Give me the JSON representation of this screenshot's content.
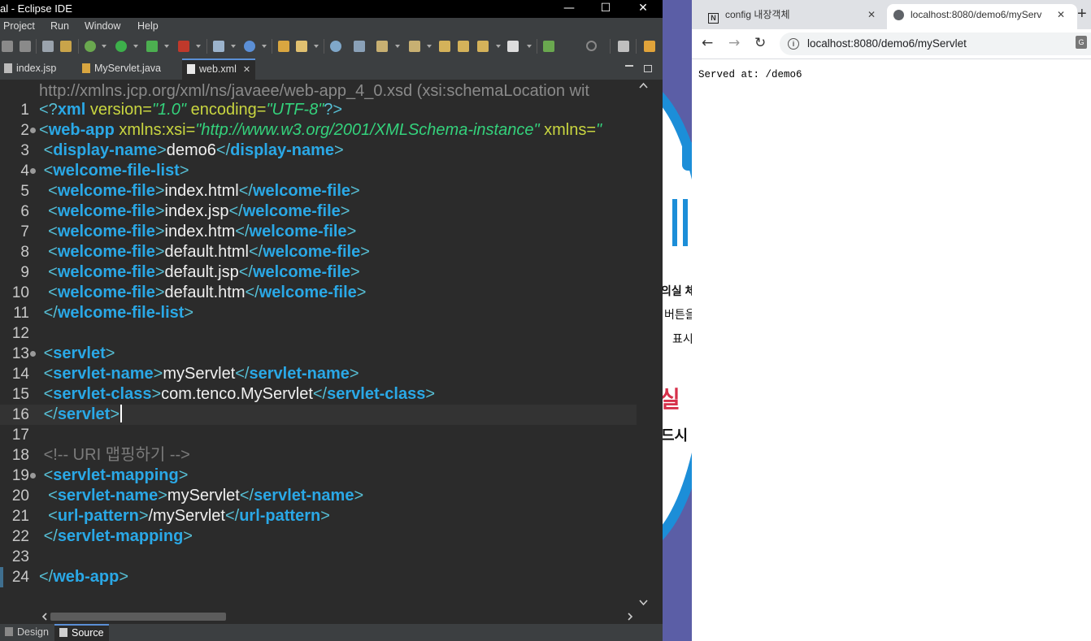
{
  "eclipse": {
    "title": "al - Eclipse IDE",
    "menu": [
      "Project",
      "Run",
      "Window",
      "Help"
    ],
    "tabs": [
      {
        "label": "index.jsp",
        "active": false
      },
      {
        "label": "MyServlet.java",
        "active": false
      },
      {
        "label": "web.xml",
        "active": true
      }
    ],
    "header_line": "http://xmlns.jcp.org/xml/ns/javaee/web-app_4_0.xsd (xsi:schemaLocation wit",
    "bottom_tabs": [
      "Design",
      "Source"
    ],
    "active_bottom_tab": "Source",
    "code": [
      {
        "n": "1",
        "fold": false,
        "tokens": [
          [
            "br",
            "<?"
          ],
          [
            "tag",
            "xml"
          ],
          [
            "attr",
            " version="
          ],
          [
            "val",
            "\"1.0\""
          ],
          [
            "attr",
            " encoding="
          ],
          [
            "val",
            "\"UTF-8\""
          ],
          [
            "br",
            "?>"
          ]
        ]
      },
      {
        "n": "2",
        "fold": true,
        "tokens": [
          [
            "br",
            "<"
          ],
          [
            "tag",
            "web-app"
          ],
          [
            "attr",
            " xmlns:xsi="
          ],
          [
            "val",
            "\"http://www.w3.org/2001/XMLSchema-instance\""
          ],
          [
            "attr",
            " xmlns="
          ],
          [
            "val",
            "\""
          ]
        ]
      },
      {
        "n": "3",
        "fold": false,
        "tokens": [
          [
            "txt",
            " "
          ],
          [
            "br",
            "<"
          ],
          [
            "tag",
            "display-name"
          ],
          [
            "br",
            ">"
          ],
          [
            "txt",
            "demo6"
          ],
          [
            "br",
            "</"
          ],
          [
            "tag",
            "display-name"
          ],
          [
            "br",
            ">"
          ]
        ]
      },
      {
        "n": "4",
        "fold": true,
        "tokens": [
          [
            "txt",
            " "
          ],
          [
            "br",
            "<"
          ],
          [
            "tag",
            "welcome-file-list"
          ],
          [
            "br",
            ">"
          ]
        ]
      },
      {
        "n": "5",
        "fold": false,
        "tokens": [
          [
            "txt",
            "  "
          ],
          [
            "br",
            "<"
          ],
          [
            "tag",
            "welcome-file"
          ],
          [
            "br",
            ">"
          ],
          [
            "txt",
            "index.html"
          ],
          [
            "br",
            "</"
          ],
          [
            "tag",
            "welcome-file"
          ],
          [
            "br",
            ">"
          ]
        ]
      },
      {
        "n": "6",
        "fold": false,
        "tokens": [
          [
            "txt",
            "  "
          ],
          [
            "br",
            "<"
          ],
          [
            "tag",
            "welcome-file"
          ],
          [
            "br",
            ">"
          ],
          [
            "txt",
            "index.jsp"
          ],
          [
            "br",
            "</"
          ],
          [
            "tag",
            "welcome-file"
          ],
          [
            "br",
            ">"
          ]
        ]
      },
      {
        "n": "7",
        "fold": false,
        "tokens": [
          [
            "txt",
            "  "
          ],
          [
            "br",
            "<"
          ],
          [
            "tag",
            "welcome-file"
          ],
          [
            "br",
            ">"
          ],
          [
            "txt",
            "index.htm"
          ],
          [
            "br",
            "</"
          ],
          [
            "tag",
            "welcome-file"
          ],
          [
            "br",
            ">"
          ]
        ]
      },
      {
        "n": "8",
        "fold": false,
        "tokens": [
          [
            "txt",
            "  "
          ],
          [
            "br",
            "<"
          ],
          [
            "tag",
            "welcome-file"
          ],
          [
            "br",
            ">"
          ],
          [
            "txt",
            "default.html"
          ],
          [
            "br",
            "</"
          ],
          [
            "tag",
            "welcome-file"
          ],
          [
            "br",
            ">"
          ]
        ]
      },
      {
        "n": "9",
        "fold": false,
        "tokens": [
          [
            "txt",
            "  "
          ],
          [
            "br",
            "<"
          ],
          [
            "tag",
            "welcome-file"
          ],
          [
            "br",
            ">"
          ],
          [
            "txt",
            "default.jsp"
          ],
          [
            "br",
            "</"
          ],
          [
            "tag",
            "welcome-file"
          ],
          [
            "br",
            ">"
          ]
        ]
      },
      {
        "n": "10",
        "fold": false,
        "tokens": [
          [
            "txt",
            "  "
          ],
          [
            "br",
            "<"
          ],
          [
            "tag",
            "welcome-file"
          ],
          [
            "br",
            ">"
          ],
          [
            "txt",
            "default.htm"
          ],
          [
            "br",
            "</"
          ],
          [
            "tag",
            "welcome-file"
          ],
          [
            "br",
            ">"
          ]
        ]
      },
      {
        "n": "11",
        "fold": false,
        "tokens": [
          [
            "txt",
            " "
          ],
          [
            "br",
            "</"
          ],
          [
            "tag",
            "welcome-file-list"
          ],
          [
            "br",
            ">"
          ]
        ]
      },
      {
        "n": "12",
        "fold": false,
        "tokens": []
      },
      {
        "n": "13",
        "fold": true,
        "tokens": [
          [
            "txt",
            " "
          ],
          [
            "br",
            "<"
          ],
          [
            "tag",
            "servlet"
          ],
          [
            "br",
            ">"
          ]
        ]
      },
      {
        "n": "14",
        "fold": false,
        "tokens": [
          [
            "txt",
            " "
          ],
          [
            "br",
            "<"
          ],
          [
            "tag",
            "servlet-name"
          ],
          [
            "br",
            ">"
          ],
          [
            "txt",
            "myServlet"
          ],
          [
            "br",
            "</"
          ],
          [
            "tag",
            "servlet-name"
          ],
          [
            "br",
            ">"
          ]
        ]
      },
      {
        "n": "15",
        "fold": false,
        "tokens": [
          [
            "txt",
            " "
          ],
          [
            "br",
            "<"
          ],
          [
            "tag",
            "servlet-class"
          ],
          [
            "br",
            ">"
          ],
          [
            "txt",
            "com.tenco.MyServlet"
          ],
          [
            "br",
            "</"
          ],
          [
            "tag",
            "servlet-class"
          ],
          [
            "br",
            ">"
          ]
        ]
      },
      {
        "n": "16",
        "fold": false,
        "current": true,
        "tokens": [
          [
            "txt",
            " "
          ],
          [
            "br",
            "</"
          ],
          [
            "tag",
            "servlet"
          ],
          [
            "br",
            ">"
          ]
        ]
      },
      {
        "n": "17",
        "fold": false,
        "tokens": []
      },
      {
        "n": "18",
        "fold": false,
        "tokens": [
          [
            "txt",
            " "
          ],
          [
            "cmt",
            "<!-- URI 맵핑하기 -->"
          ]
        ]
      },
      {
        "n": "19",
        "fold": true,
        "tokens": [
          [
            "txt",
            " "
          ],
          [
            "br",
            "<"
          ],
          [
            "tag",
            "servlet-mapping"
          ],
          [
            "br",
            ">"
          ]
        ]
      },
      {
        "n": "20",
        "fold": false,
        "tokens": [
          [
            "txt",
            "  "
          ],
          [
            "br",
            "<"
          ],
          [
            "tag",
            "servlet-name"
          ],
          [
            "br",
            ">"
          ],
          [
            "txt",
            "myServlet"
          ],
          [
            "br",
            "</"
          ],
          [
            "tag",
            "servlet-name"
          ],
          [
            "br",
            ">"
          ]
        ]
      },
      {
        "n": "21",
        "fold": false,
        "tokens": [
          [
            "txt",
            "  "
          ],
          [
            "br",
            "<"
          ],
          [
            "tag",
            "url-pattern"
          ],
          [
            "br",
            ">"
          ],
          [
            "txt",
            "/myServlet"
          ],
          [
            "br",
            "</"
          ],
          [
            "tag",
            "url-pattern"
          ],
          [
            "br",
            ">"
          ]
        ]
      },
      {
        "n": "22",
        "fold": false,
        "tokens": [
          [
            "txt",
            " "
          ],
          [
            "br",
            "</"
          ],
          [
            "tag",
            "servlet-mapping"
          ],
          [
            "br",
            ">"
          ]
        ]
      },
      {
        "n": "23",
        "fold": false,
        "tokens": []
      },
      {
        "n": "24",
        "fold": false,
        "tokens": [
          [
            "br",
            "</"
          ],
          [
            "tag",
            "web-app"
          ],
          [
            "br",
            ">"
          ]
        ]
      }
    ]
  },
  "background": {
    "texts": [
      "의실 체",
      "버튼을",
      "표시",
      "실",
      "드시"
    ]
  },
  "browser": {
    "tabs": [
      {
        "label": "config 내장객체",
        "active": false,
        "icon": "notion-icon"
      },
      {
        "label": "localhost:8080/demo6/myServ",
        "active": true,
        "icon": "globe-icon"
      }
    ],
    "new_tab_label": "+",
    "url": "localhost:8080/demo6/myServlet",
    "content": "Served at: /demo6"
  },
  "colors": {
    "tag": "#2aa8e6",
    "text": "#f0f0f0",
    "attr": "#c9d640",
    "value": "#34d27c",
    "comment": "#7b7b7b"
  }
}
